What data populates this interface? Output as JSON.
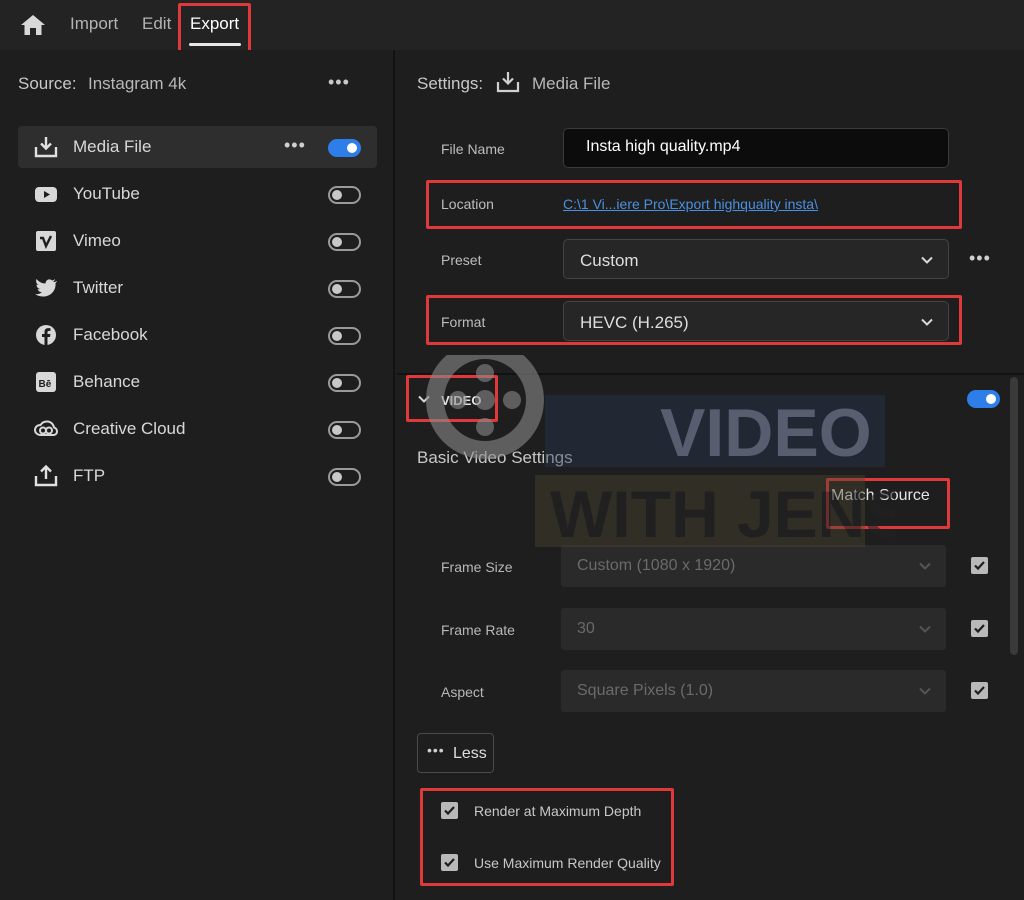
{
  "topbar": {
    "tabs": [
      "Import",
      "Edit",
      "Export"
    ],
    "active_tab": "Export",
    "home_icon": "home-icon"
  },
  "source": {
    "label": "Source:",
    "value": "Instagram 4k",
    "more": "•••"
  },
  "destinations": [
    {
      "label": "Media File",
      "icon": "download-icon",
      "enabled": true,
      "selected": true,
      "more": "•••"
    },
    {
      "label": "YouTube",
      "icon": "youtube-icon",
      "enabled": false
    },
    {
      "label": "Vimeo",
      "icon": "vimeo-icon",
      "enabled": false
    },
    {
      "label": "Twitter",
      "icon": "twitter-icon",
      "enabled": false
    },
    {
      "label": "Facebook",
      "icon": "facebook-icon",
      "enabled": false
    },
    {
      "label": "Behance",
      "icon": "behance-icon",
      "enabled": false
    },
    {
      "label": "Creative Cloud",
      "icon": "creative-cloud-icon",
      "enabled": false
    },
    {
      "label": "FTP",
      "icon": "upload-icon",
      "enabled": false
    }
  ],
  "settings": {
    "label": "Settings:",
    "value": "Media File",
    "file_name_label": "File Name",
    "file_name_value": "Insta high quality.mp4",
    "location_label": "Location",
    "location_value": "C:\\1 Vi...iere Pro\\Export highquality insta\\",
    "preset_label": "Preset",
    "preset_value": "Custom",
    "preset_more": "•••",
    "format_label": "Format",
    "format_value": "HEVC (H.265)"
  },
  "video": {
    "section_label": "VIDEO",
    "enabled": true,
    "basic_settings_label": "Basic Video Settings",
    "match_source_label": "Match Source",
    "frame_size_label": "Frame Size",
    "frame_size_value": "Custom (1080 x 1920)",
    "frame_size_checked": true,
    "frame_rate_label": "Frame Rate",
    "frame_rate_value": "30",
    "frame_rate_checked": true,
    "aspect_label": "Aspect",
    "aspect_value": "Square Pixels (1.0)",
    "aspect_checked": true,
    "less_dots": "•••",
    "less_label": "Less",
    "render_max_depth_label": "Render at Maximum Depth",
    "render_max_depth_checked": true,
    "max_render_quality_label": "Use Maximum Render Quality",
    "max_render_quality_checked": true
  },
  "watermark": {
    "line1": "VIDEO",
    "line2": "WITH JENS"
  },
  "colors": {
    "highlight": "#e0393b",
    "accent": "#2d7ee8",
    "link": "#4a90e2",
    "background": "#1e1e1e"
  }
}
